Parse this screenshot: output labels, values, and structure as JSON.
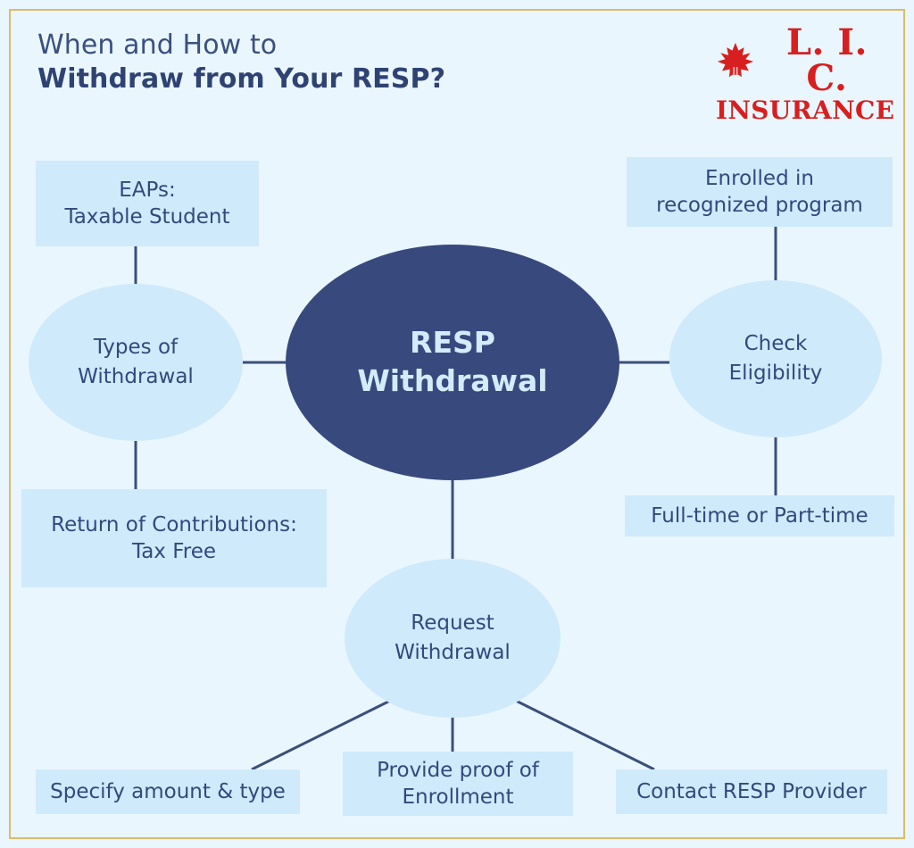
{
  "header": {
    "title_line1": "When and How to",
    "title_line2": "Withdraw from Your RESP?"
  },
  "logo": {
    "name": "L. I. C.",
    "subtitle": "INSURANCE",
    "icon": "maple-leaf-icon",
    "color": "#d81f1f"
  },
  "colors": {
    "background": "#eaf6fd",
    "frame_border": "#e0b96a",
    "node_fill": "#cfeafb",
    "center_fill": "#38497e",
    "center_text": "#d3ecfb",
    "node_text": "#33497e",
    "connector": "#3b4f7d"
  },
  "diagram": {
    "type": "mind-map",
    "center": {
      "id": "resp-withdrawal",
      "label": "RESP\nWithdrawal",
      "shape": "ellipse"
    },
    "branches": [
      {
        "id": "types-of-withdrawal",
        "label": "Types of\nWithdrawal",
        "shape": "ellipse",
        "side": "left",
        "children": [
          {
            "id": "eaps-taxable-student",
            "label": "EAPs:\nTaxable Student",
            "shape": "box",
            "position": "above"
          },
          {
            "id": "return-of-contributions",
            "label": "Return of Contributions:\nTax Free",
            "shape": "box",
            "position": "below"
          }
        ]
      },
      {
        "id": "check-eligibility",
        "label": "Check\nEligibility",
        "shape": "ellipse",
        "side": "right",
        "children": [
          {
            "id": "enrolled-in-recognized-program",
            "label": "Enrolled in\nrecognized program",
            "shape": "box",
            "position": "above"
          },
          {
            "id": "full-time-or-part-time",
            "label": "Full-time or Part-time",
            "shape": "box",
            "position": "below"
          }
        ]
      },
      {
        "id": "request-withdrawal",
        "label": "Request\nWithdrawal",
        "shape": "ellipse",
        "side": "bottom",
        "children": [
          {
            "id": "specify-amount-type",
            "label": "Specify amount & type",
            "shape": "box",
            "position": "below-left"
          },
          {
            "id": "provide-proof-of-enrollment",
            "label": "Provide proof of\nEnrollment",
            "shape": "box",
            "position": "below-center"
          },
          {
            "id": "contact-resp-provider",
            "label": "Contact RESP Provider",
            "shape": "box",
            "position": "below-right"
          }
        ]
      }
    ]
  }
}
